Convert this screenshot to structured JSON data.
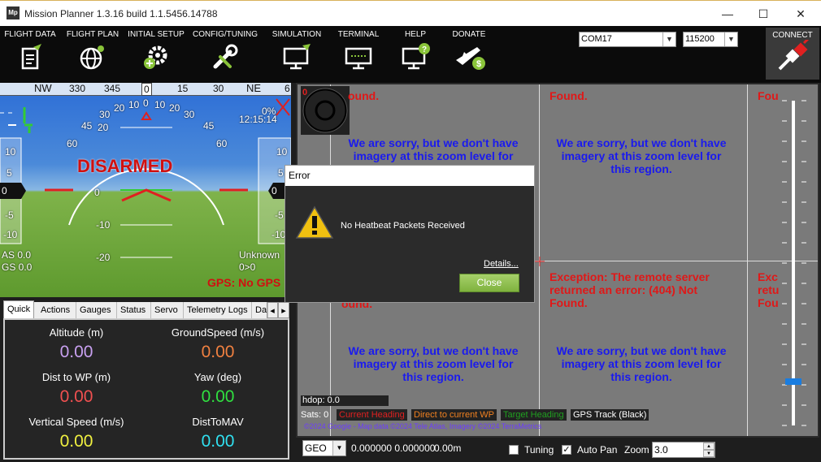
{
  "window": {
    "app_icon": "Mp",
    "title": "Mission Planner 1.3.16 build 1.1.5456.14788",
    "minimize": "—",
    "maximize": "☐",
    "close": "✕"
  },
  "toolbar": {
    "menu": [
      {
        "label": "FLIGHT DATA",
        "icon": "flight-data-icon"
      },
      {
        "label": "FLIGHT PLAN",
        "icon": "flight-plan-icon"
      },
      {
        "label": "INITIAL SETUP",
        "icon": "initial-setup-icon"
      },
      {
        "label": "CONFIG/TUNING",
        "icon": "config-tuning-icon"
      },
      {
        "label": "SIMULATION",
        "icon": "simulation-icon"
      },
      {
        "label": "TERMINAL",
        "icon": "terminal-icon"
      },
      {
        "label": "HELP",
        "icon": "help-icon"
      },
      {
        "label": "DONATE",
        "icon": "donate-icon"
      }
    ],
    "port": "COM17",
    "baud": "115200",
    "connect_label": "CONNECT"
  },
  "hud": {
    "compass": [
      "NW",
      "330",
      "345",
      "0",
      "15",
      "30",
      "NE",
      "6"
    ],
    "status": "DISARMED",
    "pitch_labels": [
      "20",
      "10",
      "0",
      "-10",
      "-20"
    ],
    "roll_labels": [
      "60",
      "45",
      "30",
      "20",
      "10",
      "0",
      "10",
      "20",
      "30",
      "45",
      "60"
    ],
    "left_scale": [
      "10",
      "5",
      "0",
      "-5",
      "-10"
    ],
    "right_scale": [
      "10",
      "5",
      "0",
      "-5",
      "-10"
    ],
    "battery_pct": "0%",
    "time": "12:15:14",
    "airspeed": "AS 0.0",
    "groundspeed": "GS 0.0",
    "mode": "Unknown",
    "wp": "0>0",
    "gps_status": "GPS: No GPS"
  },
  "tabs": {
    "items": [
      "Quick",
      "Actions",
      "Gauges",
      "Status",
      "Servo",
      "Telemetry Logs",
      "Da"
    ],
    "scroll_left": "◂",
    "scroll_right": "▸"
  },
  "quick": {
    "items": [
      {
        "label": "Altitude (m)",
        "value": "0.00",
        "color": "#c8a0f0"
      },
      {
        "label": "GroundSpeed (m/s)",
        "value": "0.00",
        "color": "#f08040"
      },
      {
        "label": "Dist to WP (m)",
        "value": "0.00",
        "color": "#f05050"
      },
      {
        "label": "Yaw (deg)",
        "value": "0.00",
        "color": "#30e040"
      },
      {
        "label": "Vertical Speed (m/s)",
        "value": "0.00",
        "color": "#f0f040"
      },
      {
        "label": "DistToMAV",
        "value": "0.00",
        "color": "#30e0f0"
      }
    ]
  },
  "map": {
    "tile_error": "Exception: The remote server returned an error: (404) Not Found.",
    "tile_error_end": "ound.",
    "tile_error_found": "Found.",
    "tile_error_fou": "Fou",
    "tile_error_exc": "Exc",
    "tile_error_retu": "retu",
    "tile_sorry": "We are sorry, but we don't have imagery at this zoom level for this region.",
    "hdop": "hdop: 0.0",
    "sats": "Sats: 0",
    "legend": [
      {
        "label": "Current Heading",
        "color": "#e02020"
      },
      {
        "label": "Direct to current WP",
        "color": "#f08020"
      },
      {
        "label": "Target Heading",
        "color": "#20a020"
      },
      {
        "label": "GPS Track (Black)",
        "color": "#ffffff"
      }
    ],
    "attribution": "©2024 Google - Map data ©2024 Tele Atlas, Imagery ©2024 TerraMetrics"
  },
  "bottombar": {
    "coord_type": "GEO",
    "coords": "0.000000 0.000000",
    "alt": "0.00m",
    "tuning_label": "Tuning",
    "tuning_checked": false,
    "autopan_label": "Auto Pan",
    "autopan_checked": true,
    "zoom_label": "Zoom",
    "zoom_value": "3.0"
  },
  "dialog": {
    "title": "Error",
    "message": "No Heatbeat Packets Received",
    "details_label": "Details...",
    "close_label": "Close"
  }
}
